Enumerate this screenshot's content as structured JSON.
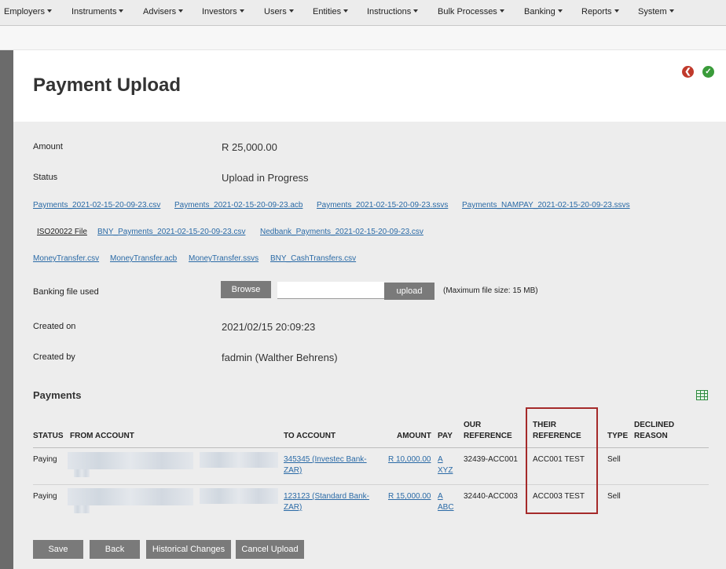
{
  "nav": [
    "Employers",
    "Instruments",
    "Advisers",
    "Investors",
    "Users",
    "Entities",
    "Instructions",
    "Bulk Processes",
    "Banking",
    "Reports",
    "System"
  ],
  "page": {
    "title": "Payment Upload"
  },
  "header_icons": [
    "back-circle-icon",
    "check-circle-icon"
  ],
  "amount": {
    "label": "Amount",
    "value": "R 25,000.00"
  },
  "status": {
    "label": "Status",
    "value": "Upload in Progress"
  },
  "files": {
    "row1": [
      "Payments_2021-02-15-20-09-23.csv",
      "Payments_2021-02-15-20-09-23.acb",
      "Payments_2021-02-15-20-09-23.ssvs",
      "Payments_NAMPAY_2021-02-15-20-09-23.ssvs"
    ],
    "row2": [
      "ISO20022 File",
      "BNY_Payments_2021-02-15-20-09-23.csv",
      "Nedbank_Payments_2021-02-15-20-09-23.csv"
    ],
    "row3": [
      "MoneyTransfer.csv",
      "MoneyTransfer.acb",
      "MoneyTransfer.ssvs",
      "BNY_CashTransfers.csv"
    ]
  },
  "banking_file": {
    "label": "Banking file used",
    "browse": "Browse",
    "upload": "upload",
    "note": "(Maximum file size: 15 MB)"
  },
  "created_on": {
    "label": "Created on",
    "value": "2021/02/15 20:09:23"
  },
  "created_by": {
    "label": "Created by",
    "value": "fadmin (Walther Behrens)"
  },
  "payments": {
    "title": "Payments",
    "headers": {
      "status": "STATUS",
      "from_account": "FROM ACCOUNT",
      "to_account": "TO ACCOUNT",
      "amount": "AMOUNT",
      "pay": "PAY",
      "our_ref_1": "OUR",
      "our_ref_2": "REFERENCE",
      "their_ref_1": "THEIR",
      "their_ref_2": "REFERENCE",
      "type": "TYPE",
      "declined_1": "DECLINED",
      "declined_2": "REASON"
    },
    "rows": [
      {
        "status": "Paying",
        "to_1": "345345 (Investec Bank-",
        "to_2": "ZAR)",
        "amount": "R 10,000.00",
        "pay_1": "A",
        "pay_2": "XYZ",
        "our_ref": "32439-ACC001",
        "their_ref": "ACC001 TEST",
        "type": "Sell"
      },
      {
        "status": "Paying",
        "to_1": "123123 (Standard Bank-",
        "to_2": "ZAR)",
        "amount": "R 15,000.00",
        "pay_1": "A",
        "pay_2": "ABC",
        "our_ref": "32440-ACC003",
        "their_ref": "ACC003 TEST",
        "type": "Sell"
      }
    ]
  },
  "actions": {
    "save": "Save",
    "back": "Back",
    "history": "Historical Changes",
    "cancel": "Cancel Upload"
  },
  "colors": {
    "highlight": "#a52a2a",
    "link": "#2a6aa6",
    "button": "#7a7a7a"
  }
}
